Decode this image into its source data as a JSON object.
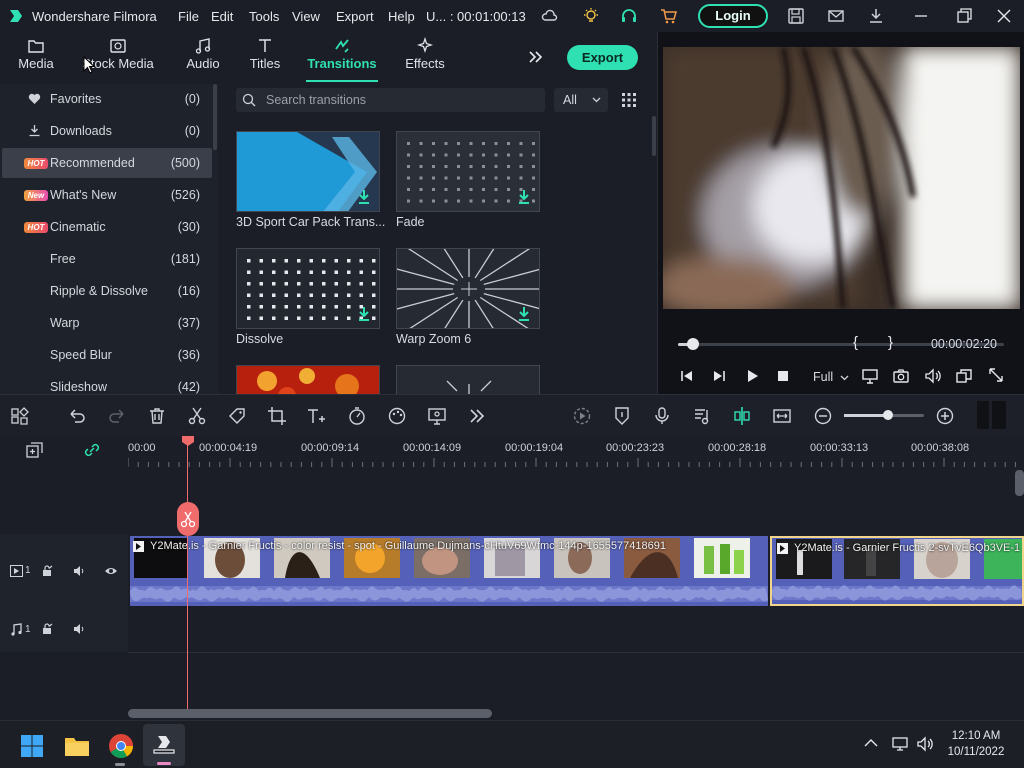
{
  "titlebar": {
    "app_name": "Wondershare Filmora",
    "menu": [
      "File",
      "Edit",
      "Tools",
      "View",
      "Export",
      "Help"
    ],
    "project": "U... : 00:01:00:13",
    "login_label": "Login"
  },
  "tabs": [
    {
      "label": "Media",
      "icon": "folder-icon"
    },
    {
      "label": "Stock Media",
      "icon": "image-icon"
    },
    {
      "label": "Audio",
      "icon": "music-icon"
    },
    {
      "label": "Titles",
      "icon": "text-icon"
    },
    {
      "label": "Transitions",
      "icon": "transition-icon",
      "active": true
    },
    {
      "label": "Effects",
      "icon": "effects-icon"
    }
  ],
  "export_label": "Export",
  "sidebar": {
    "items": [
      {
        "label": "Favorites",
        "count": "(0)"
      },
      {
        "label": "Downloads",
        "count": "(0)"
      },
      {
        "label": "Recommended",
        "count": "(500)",
        "badge": "HOT",
        "selected": true
      },
      {
        "label": "What's New",
        "count": "(526)",
        "badge": "New"
      },
      {
        "label": "Cinematic",
        "count": "(30)",
        "badge": "HOT"
      },
      {
        "label": "Free",
        "count": "(181)"
      },
      {
        "label": "Ripple & Dissolve",
        "count": "(16)"
      },
      {
        "label": "Warp",
        "count": "(37)"
      },
      {
        "label": "Speed Blur",
        "count": "(36)"
      },
      {
        "label": "Slideshow",
        "count": "(42)"
      }
    ]
  },
  "search": {
    "placeholder": "Search transitions"
  },
  "filter_value": "All",
  "transitions": [
    {
      "label": "3D Sport Car Pack Trans..."
    },
    {
      "label": "Fade"
    },
    {
      "label": "Dissolve"
    },
    {
      "label": "Warp Zoom 6"
    }
  ],
  "player": {
    "mark_in": "{",
    "mark_out": "}",
    "time": "00:00:02:20",
    "quality": "Full",
    "progress": 0.04
  },
  "ruler": {
    "ticks": [
      "00:00",
      "00:00:04:19",
      "00:00:09:14",
      "00:00:14:09",
      "00:00:19:04",
      "00:00:23:23",
      "00:00:28:18",
      "00:00:33:13",
      "00:00:38:08"
    ]
  },
  "timeline": {
    "clip1_title": "Y2Mate.is - Garnier Fructis - color resist - spot - Guillaume Dujmans-cHtuV69Wfmc-144p-1655577418691",
    "clip2_title": "Y2Mate.is - Garnier Fructis 2-svTvE6Qb3VE-1",
    "video_track": "1",
    "audio_track": "1",
    "zoom": 0.55
  },
  "taskbar": {
    "time": "12:10 AM",
    "date": "10/11/2022"
  },
  "colors": {
    "accent": "#2fe0b3",
    "playhead": "#f06b6b",
    "clip_bg": "#5561b8",
    "selected_clip_border": "#f0d58a"
  }
}
